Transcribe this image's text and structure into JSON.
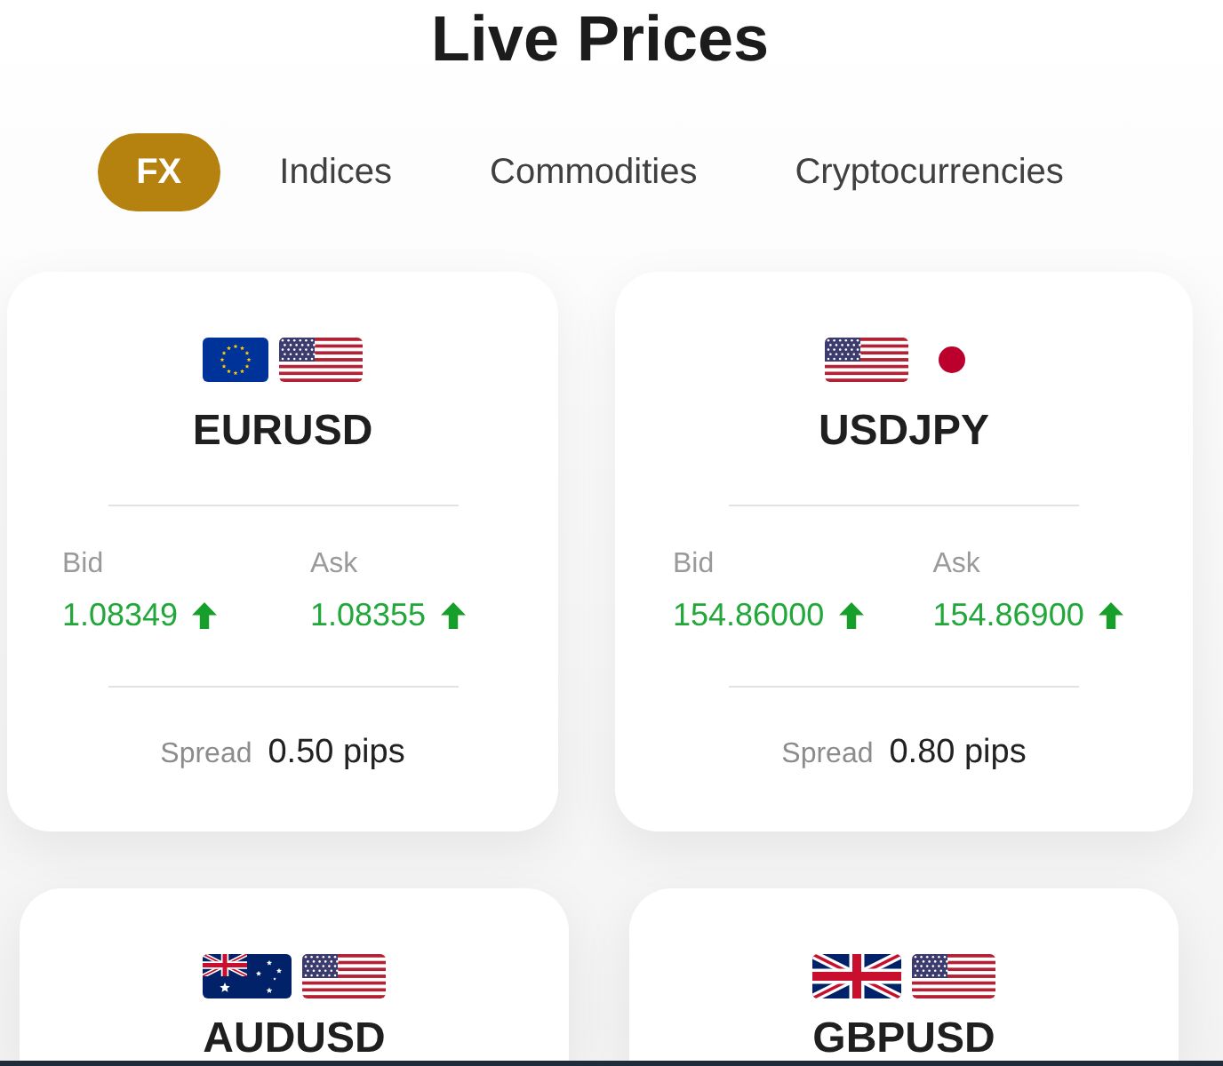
{
  "title": "Live Prices",
  "tabs": [
    {
      "label": "FX",
      "selected": true
    },
    {
      "label": "Indices",
      "selected": false
    },
    {
      "label": "Commodities",
      "selected": false
    },
    {
      "label": "Cryptocurrencies",
      "selected": false
    }
  ],
  "cards": [
    {
      "flags": [
        {
          "kind": "eu"
        },
        {
          "kind": "us"
        }
      ],
      "symbol": "EURUSD",
      "bid": {
        "label": "Bid",
        "value": "1.08349",
        "rising": true
      },
      "ask": {
        "label": "Ask",
        "value": "1.08355",
        "rising": true
      },
      "spread": {
        "label": "Spread",
        "value": "0.50 pips"
      }
    },
    {
      "flags": [
        {
          "kind": "us"
        },
        {
          "kind": "jp"
        }
      ],
      "symbol": "USDJPY",
      "bid": {
        "label": "Bid",
        "value": "154.86000",
        "rising": true
      },
      "ask": {
        "label": "Ask",
        "value": "154.86900",
        "rising": true
      },
      "spread": {
        "label": "Spread",
        "value": "0.80 pips"
      }
    },
    {
      "flags": [
        {
          "kind": "au"
        },
        {
          "kind": "us"
        }
      ],
      "symbol": "AUDUSD"
    },
    {
      "flags": [
        {
          "kind": "gb"
        },
        {
          "kind": "us"
        }
      ],
      "symbol": "GBPUSD"
    }
  ]
}
